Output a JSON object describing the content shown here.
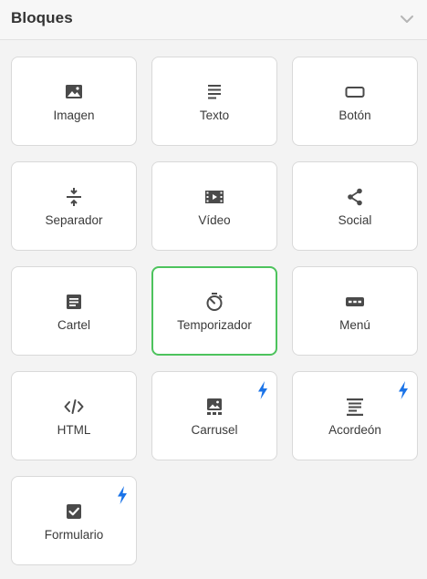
{
  "panel": {
    "title": "Bloques",
    "collapse_icon": "chevron-down-icon"
  },
  "blocks": [
    {
      "label": "Imagen",
      "icon": "image-icon",
      "premium": false,
      "selected": false
    },
    {
      "label": "Texto",
      "icon": "text-icon",
      "premium": false,
      "selected": false
    },
    {
      "label": "Botón",
      "icon": "button-icon",
      "premium": false,
      "selected": false
    },
    {
      "label": "Separador",
      "icon": "separator-icon",
      "premium": false,
      "selected": false
    },
    {
      "label": "Vídeo",
      "icon": "video-icon",
      "premium": false,
      "selected": false
    },
    {
      "label": "Social",
      "icon": "share-icon",
      "premium": false,
      "selected": false
    },
    {
      "label": "Cartel",
      "icon": "banner-icon",
      "premium": false,
      "selected": false
    },
    {
      "label": "Temporizador",
      "icon": "timer-icon",
      "premium": false,
      "selected": true
    },
    {
      "label": "Menú",
      "icon": "menu-icon",
      "premium": false,
      "selected": false
    },
    {
      "label": "HTML",
      "icon": "code-icon",
      "premium": false,
      "selected": false
    },
    {
      "label": "Carrusel",
      "icon": "carousel-icon",
      "premium": true,
      "selected": false
    },
    {
      "label": "Acordeón",
      "icon": "accordion-icon",
      "premium": true,
      "selected": false
    },
    {
      "label": "Formulario",
      "icon": "form-icon",
      "premium": true,
      "selected": false
    }
  ],
  "colors": {
    "icon": "#4a4a4a",
    "selected_border": "#4dc35d",
    "premium_bolt": "#1a73e8"
  }
}
